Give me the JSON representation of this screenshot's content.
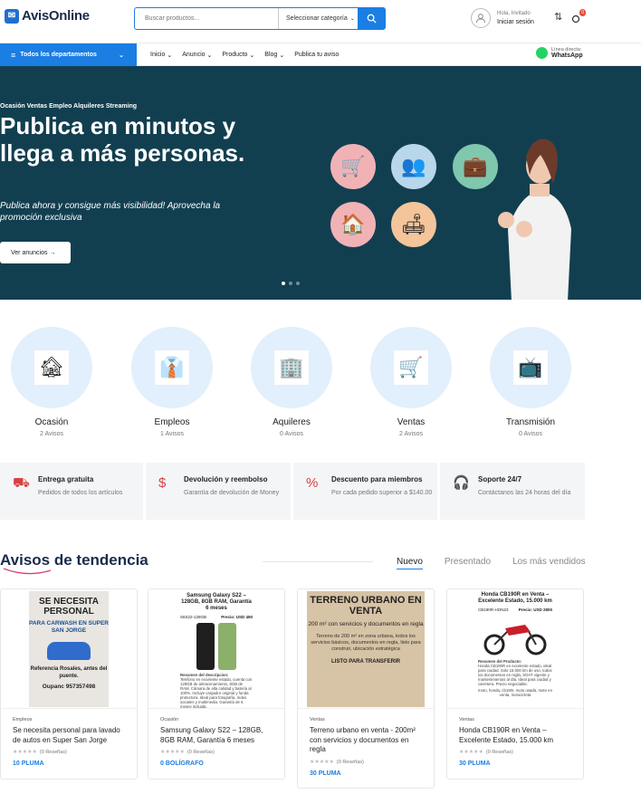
{
  "header": {
    "logo_text": "AvisOnline",
    "search_placeholder": "Buscar productos...",
    "category_select": "Seleccionar categoría",
    "greeting": "Hola, Invitado",
    "login": "Iniciar sesión",
    "cart_count": "0"
  },
  "nav": {
    "departments": "Todos los departamentos",
    "links": [
      "Inicio",
      "Anuncio",
      "Producto",
      "Blog"
    ],
    "publish": "Publica tu aviso",
    "whatsapp_label": "Línea directa:",
    "whatsapp": "WhatsApp"
  },
  "hero": {
    "kicker": "Ocasión Ventas Empleo Alquileres Streaming",
    "title": "Publica en minutos y llega a más personas.",
    "subtitle": "Publica ahora y consigue más visibilidad! Aprovecha la promoción exclusiva",
    "button": "Ver anuncios",
    "active_slide": 1,
    "total_slides": 3
  },
  "categories": [
    {
      "name": "Ocasión",
      "count": "2 Avisos",
      "icon": "house-rent-icon"
    },
    {
      "name": "Empleos",
      "count": "1 Avisos",
      "icon": "jobs-grid-icon"
    },
    {
      "name": "Aquileres",
      "count": "0 Avisos",
      "icon": "building-icon"
    },
    {
      "name": "Ventas",
      "count": "2 Avisos",
      "icon": "shopping-cart-icon"
    },
    {
      "name": "Transmisión",
      "count": "0 Avisos",
      "icon": "streaming-logos-icon"
    }
  ],
  "features": [
    {
      "title": "Entrega gratuita",
      "desc": "Pedidos de todos los artículos",
      "icon": "truck-icon"
    },
    {
      "title": "Devolución y reembolso",
      "desc": "Garantía de devolución de Money",
      "icon": "dollar-icon"
    },
    {
      "title": "Descuento para miembros",
      "desc": "Por cada pedido superior a $140.00",
      "icon": "discount-icon"
    },
    {
      "title": "Soporte 24/7",
      "desc": "Contáctanos las 24 horas del día",
      "icon": "headset-icon"
    }
  ],
  "trending": {
    "title": "Avisos de tendencia",
    "tabs": [
      "Nuevo",
      "Presentado",
      "Los más vendidos"
    ],
    "active_tab": "Nuevo"
  },
  "products": [
    {
      "category": "Empleos",
      "title": "Se necesita personal para lavado de autos en Super San Jorge",
      "reviews": "(0 Reseñas)",
      "price": "10 PLUMA",
      "poster": {
        "a": "SE NECESITA PERSONAL",
        "b": "PARA CARWASH EN SUPER SAN JORGE",
        "c": "Referencia Rosales, antes del puente.",
        "d": "Oupanc 957357498"
      }
    },
    {
      "category": "Ocasión",
      "title": "Samsung Galaxy S22 – 128GB, 8GB RAM, Garantía 6 meses",
      "reviews": "(0 Reseñas)",
      "price": "0 BOLÍGRAFO",
      "poster": {
        "t": "Samsung Galaxy S22 – 128GB, 8GB RAM, Garantía 6 meses",
        "l": "S6S22-128GB",
        "r": "Precio: USD 450",
        "ds_title": "Resumen del descripcion:",
        "ds": "Teléfono en excelente estado, cuenta con 128GB de almacenamiento, 8GB de RAM. Cámara de alta calidad y batería al 100%. Incluye cargador original y funda protectora. Ideal para fotografía, redes sociales y multimedia. Garantía de 6 meses incluida."
      }
    },
    {
      "category": "Ventas",
      "title": "Terreno urbano en venta - 200m² con servicios y documentos en regla",
      "reviews": "(0 Reseñas)",
      "price": "30 PLUMA",
      "poster": {
        "a": "TERRENO URBANO EN VENTA",
        "b": "200 m² con servicios y documentos en regla",
        "c": "Terreno de 200 m² en zona urbana, todos los servicios básicos, documentos en regla, listo para construir, ubicación estratégica",
        "d": "LISTO PARA TRANSFERIR"
      }
    },
    {
      "category": "Ventas",
      "title": "Honda CB190R en Venta – Excelente Estado, 15.000 km",
      "reviews": "(0 Reseñas)",
      "price": "30 PLUMA",
      "poster": {
        "t": "Honda CB190R en Venta – Excelente Estado, 15.000 km",
        "l": "CB190R-HON23",
        "r": "Precio: USD 2800",
        "ds_title": "Resumen del Producto:",
        "ds": "Honda CB190R en excelente estado, ideal para ciudad. Solo 15.000 km de uso, todos los documentos en regla, SOAT vigente y mantenimientos al día. Ideal para ciudad y carretera. Precio negociable.",
        "ds2": "moto, honda, cb190r, moto usada, moto en venta, motocicleta"
      }
    }
  ],
  "colors": {
    "brand": "#1a7ee3",
    "hero_bg": "#123f50",
    "navy": "#1a2b4c",
    "accent_red": "#d94141"
  }
}
